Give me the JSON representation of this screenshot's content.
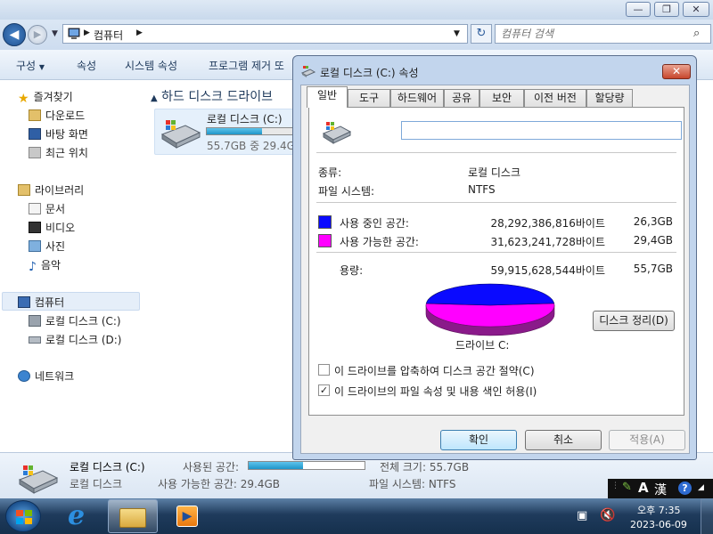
{
  "explorer": {
    "breadcrumb": "컴퓨터",
    "search_placeholder": "컴퓨터 검색",
    "toolbar": [
      "구성",
      "속성",
      "시스템 속성",
      "프로그램 제거 또"
    ],
    "sidebar": {
      "favorites": "즐겨찾기",
      "downloads": "다운로드",
      "desktop": "바탕 화면",
      "recent": "최근 위치",
      "libraries": "라이브러리",
      "documents": "문서",
      "videos": "비디오",
      "pictures": "사진",
      "music": "음악",
      "computer": "컴퓨터",
      "drive_c": "로컬 디스크 (C:)",
      "drive_d": "로컬 디스크 (D:)",
      "network": "네트워크"
    },
    "content": {
      "section_header": "하드 디스크 드라이브",
      "drive_name": "로컬 디스크 (C:)",
      "drive_free_text": "55.7GB 중 29.4GB",
      "drive_used_fraction": 0.47
    },
    "status": {
      "name": "로컬 디스크 (C:)",
      "type": "로컬 디스크",
      "used_label": "사용된 공간:",
      "used_fraction": 0.47,
      "free": "사용 가능한 공간: 29.4GB",
      "total": "전체 크기: 55.7GB",
      "filesystem": "파일 시스템: NTFS"
    }
  },
  "dialog": {
    "title": "로컬 디스크 (C:) 속성",
    "tabs": [
      "일반",
      "도구",
      "하드웨어",
      "공유",
      "보안",
      "이전 버전",
      "할당량"
    ],
    "active_tab": "일반",
    "volume_label": "",
    "type_label": "종류:",
    "type_value": "로컬 디스크",
    "fs_label": "파일 시스템:",
    "fs_value": "NTFS",
    "used_label": "사용 중인 공간:",
    "used_bytes": "28,292,386,816바이트",
    "used_gb": "26,3GB",
    "free_label": "사용 가능한 공간:",
    "free_bytes": "31,623,241,728바이트",
    "free_gb": "29,4GB",
    "capacity_label": "용량:",
    "capacity_bytes": "59,915,628,544바이트",
    "capacity_gb": "55,7GB",
    "used_color": "#0a0aff",
    "free_color": "#ff00ff",
    "used_fraction": 0.472,
    "drive_label": "드라이브 C:",
    "cleanup_button": "디스크 정리(D)",
    "compress_label": "이 드라이브를 압축하여 디스크 공간 절약(C)",
    "compress_checked": false,
    "index_label": "이 드라이브의 파일 속성 및 내용 색인 허용(I)",
    "index_checked": true,
    "ok_button": "확인",
    "cancel_button": "취소",
    "apply_button": "적용(A)"
  },
  "taskbar": {
    "time": "오후 7:35",
    "date": "2023-06-09",
    "ime_mode": "A",
    "ime_hanja": "漢"
  }
}
